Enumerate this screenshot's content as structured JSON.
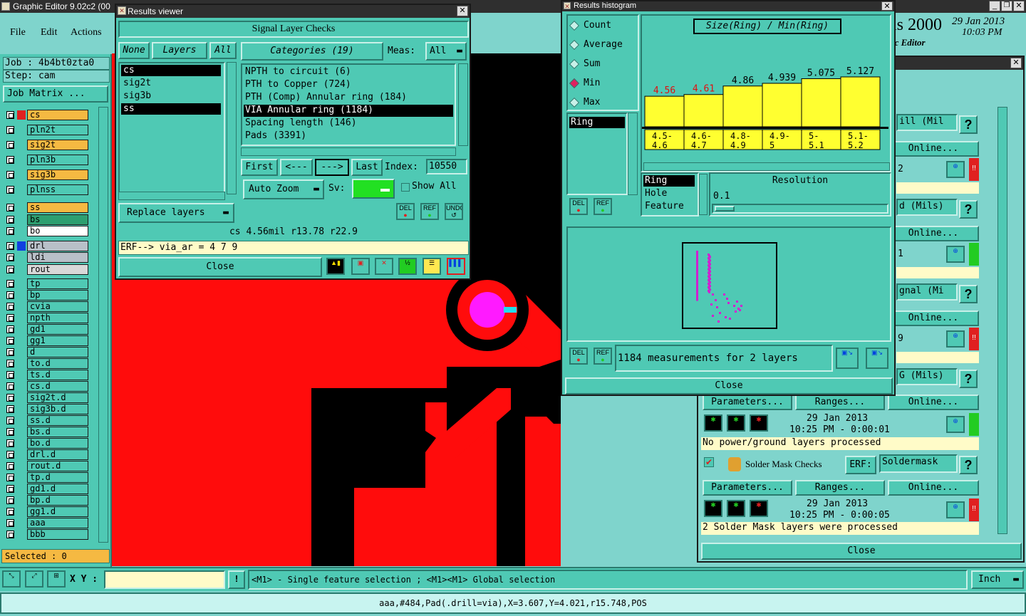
{
  "app": {
    "title": "Graphic Editor 9.02c2 (00",
    "menu": [
      "File",
      "Edit",
      "Actions"
    ],
    "logo_text": "is 2000",
    "logo_sub": "ic Editor",
    "date": "29 Jan 2013",
    "time": "10:03 PM"
  },
  "left_panel": {
    "job": "Job : 4b4bt0zta0",
    "step": "Step: cam",
    "job_matrix": "Job Matrix ...",
    "selected": "Selected : 0",
    "layers": [
      {
        "name": "cs",
        "color": "#f5b942",
        "swatch": "#e02020"
      },
      {
        "name": "pln2t",
        "color": "#4fc9b4"
      },
      {
        "name": "sig2t",
        "color": "#f5b942"
      },
      {
        "name": "pln3b",
        "color": "#4fc9b4"
      },
      {
        "name": "sig3b",
        "color": "#f5b942"
      },
      {
        "name": "plnss",
        "color": "#4fc9b4"
      },
      {
        "name": "ss",
        "color": "#f5b942"
      },
      {
        "name": "bs",
        "color": "#2e9f70"
      },
      {
        "name": "bo",
        "color": "#ffffff"
      },
      {
        "name": "drl",
        "color": "#b8c0c8",
        "swatch": "#1040e0"
      },
      {
        "name": "ldi",
        "color": "#b8c0c8"
      },
      {
        "name": "rout",
        "color": "#d8d8d8"
      },
      {
        "name": "tp",
        "color": "#4fc9b4"
      },
      {
        "name": "bp",
        "color": "#4fc9b4"
      },
      {
        "name": "cvia",
        "color": "#4fc9b4"
      },
      {
        "name": "npth",
        "color": "#4fc9b4"
      },
      {
        "name": "gd1",
        "color": "#4fc9b4"
      },
      {
        "name": "gg1",
        "color": "#4fc9b4"
      },
      {
        "name": "d",
        "color": "#4fc9b4"
      },
      {
        "name": "to.d",
        "color": "#4fc9b4"
      },
      {
        "name": "ts.d",
        "color": "#4fc9b4"
      },
      {
        "name": "cs.d",
        "color": "#4fc9b4"
      },
      {
        "name": "sig2t.d",
        "color": "#4fc9b4"
      },
      {
        "name": "sig3b.d",
        "color": "#4fc9b4"
      },
      {
        "name": "ss.d",
        "color": "#4fc9b4"
      },
      {
        "name": "bs.d",
        "color": "#4fc9b4"
      },
      {
        "name": "bo.d",
        "color": "#4fc9b4"
      },
      {
        "name": "drl.d",
        "color": "#4fc9b4"
      },
      {
        "name": "rout.d",
        "color": "#4fc9b4"
      },
      {
        "name": "tp.d",
        "color": "#4fc9b4"
      },
      {
        "name": "gd1.d",
        "color": "#4fc9b4"
      },
      {
        "name": "bp.d",
        "color": "#4fc9b4"
      },
      {
        "name": "gg1.d",
        "color": "#4fc9b4"
      },
      {
        "name": "aaa",
        "color": "#4fc9b4"
      },
      {
        "name": "bbb",
        "color": "#4fc9b4"
      }
    ]
  },
  "results_viewer": {
    "title": "Results viewer",
    "header": "Signal Layer Checks",
    "none_btn": "None",
    "layers_btn": "Layers",
    "all_btn": "All",
    "layer_list": [
      "cs",
      "sig2t",
      "sig3b",
      "ss"
    ],
    "categories_btn": "Categories (19)",
    "meas_label": "Meas:",
    "meas_value": "All",
    "categories": [
      "NPTH to circuit (6)",
      "PTH to Copper (724)",
      "PTH (Comp) Annular ring (184)",
      "VIA Annular ring (1184)",
      "Spacing length (146)",
      "Pads (3391)"
    ],
    "first_btn": "First",
    "prev_btn": "<---",
    "next_btn": "--->",
    "last_btn": "Last",
    "index_label": "Index:",
    "index_value": "10550",
    "auto_zoom": "Auto Zoom",
    "sv_label": "Sv:",
    "show_all": "Show All",
    "replace_layers": "Replace layers",
    "del": "DEL",
    "ref": "REF",
    "undo": "UNDO",
    "status": "cs 4.56mil  r13.78  r22.9",
    "erf": "ERF--> via_ar = 4 7 9",
    "close": "Close"
  },
  "histogram": {
    "title": "Results histogram",
    "chart_title": "Size(Ring) / Min(Ring)",
    "modes": [
      "Count",
      "Average",
      "Sum",
      "Min",
      "Max"
    ],
    "selected_mode": "Min",
    "ring_item": "Ring",
    "list2": [
      "Ring",
      "Hole",
      "Feature"
    ],
    "resolution_label": "Resolution",
    "resolution_value": "0.1",
    "measurements": "1184 measurements for 2 layers",
    "close": "Close",
    "del": "DEL",
    "ref": "REF"
  },
  "chart_data": {
    "type": "bar",
    "title": "Size(Ring) / Min(Ring)",
    "categories": [
      "4.5-4.6",
      "4.6-4.7",
      "4.8-4.9",
      "4.9-5",
      "5-5.1",
      "5.1-5.2"
    ],
    "values": [
      4.56,
      4.61,
      4.86,
      4.939,
      5.075,
      5.127
    ],
    "value_labels": [
      "4.56",
      "4.61",
      "4.86",
      "4.939",
      "5.075",
      "5.127"
    ],
    "label_colors": [
      "#e01010",
      "#e01010",
      "#000000",
      "#000000",
      "#000000",
      "#000000"
    ],
    "bin_labels_top": [
      "4.5-",
      "4.6-",
      "4.8-",
      "4.9-",
      "5-",
      "5.1-"
    ],
    "bin_labels_bottom": [
      "4.6",
      "4.7",
      "4.9",
      "5",
      "5.1",
      "5.2"
    ],
    "bar_color": "#ffff30"
  },
  "checklist": {
    "rows": [
      {
        "label": "ill (Mil",
        "online": "Online...",
        "value": "2",
        "flag": "!!",
        "flag_color": "#e02020"
      },
      {
        "label": "d (Mils)",
        "online": "Online...",
        "value": "1",
        "flag": "",
        "flag_color": "#22cc22"
      },
      {
        "label": "gnal (Mi",
        "online": "Online...",
        "value": "9",
        "flag": "!!",
        "flag_color": "#e02020"
      },
      {
        "label": "G (Mils)",
        "online": "",
        "value": "",
        "flag": "",
        "flag_color": "#22cc22"
      }
    ],
    "parameters": "Parameters...",
    "ranges": "Ranges...",
    "online": "Online...",
    "run1_date": "29 Jan 2013",
    "run1_time": "10:25 PM - 0:00:01",
    "run1_msg": "No power/ground layers processed",
    "solder_title": "Solder Mask Checks",
    "erf_label": "ERF:",
    "erf_value": "Soldermask",
    "run2_date": "29 Jan 2013",
    "run2_time": "10:25 PM - 0:00:05",
    "run2_msg": "2 Solder Mask layers were processed",
    "close": "Close",
    "help": "?"
  },
  "bottom": {
    "xy_label": "X Y :",
    "xy_value": "",
    "warn": "!",
    "hint": "<M1> - Single feature selection ; <M1><M1> Global selection",
    "units": "Inch",
    "status": "aaa,#484,Pad(.drill=via),X=3.607,Y=4.021,r15.748,POS"
  }
}
